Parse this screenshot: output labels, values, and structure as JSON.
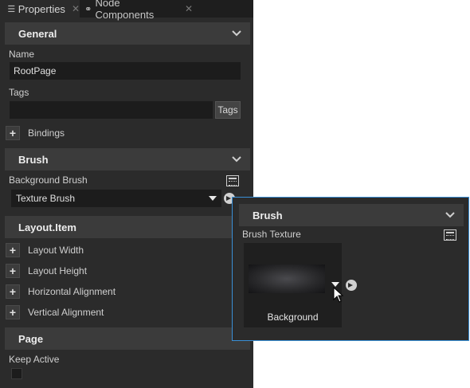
{
  "tabs": [
    {
      "label": "Properties",
      "icon": "list-icon",
      "active": true
    },
    {
      "label": "Node Components",
      "icon": "node-components-icon",
      "active": false
    }
  ],
  "general": {
    "header": "General",
    "name_label": "Name",
    "name_value": "RootPage",
    "tags_label": "Tags",
    "tags_value": "",
    "tags_button": "Tags",
    "bindings_label": "Bindings"
  },
  "brush": {
    "header": "Brush",
    "background_brush_label": "Background Brush",
    "background_brush_value": "Texture Brush"
  },
  "layout_item": {
    "header": "Layout.Item",
    "items": [
      "Layout Width",
      "Layout Height",
      "Horizontal Alignment",
      "Vertical Alignment"
    ]
  },
  "page": {
    "header": "Page",
    "keep_active_label": "Keep Active",
    "keep_active_checked": false
  },
  "popup": {
    "header": "Brush",
    "brush_texture_label": "Brush Texture",
    "texture_name": "Background"
  },
  "colors": {
    "panel_bg": "#2b2b2b",
    "header_bg": "#3b3b3b",
    "field_bg": "#1c1c1c",
    "popup_border": "#3a8fd6"
  }
}
